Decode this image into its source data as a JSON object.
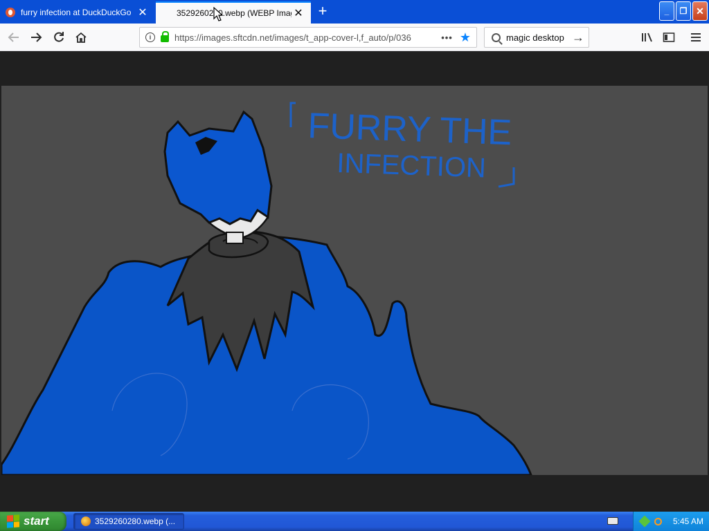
{
  "browser": {
    "tabs": [
      {
        "title": "furry infection at DuckDuckGo",
        "active": false
      },
      {
        "title": "3529260280.webp (WEBP Image,",
        "active": true
      }
    ],
    "url": "https://images.sftcdn.net/images/t_app-cover-l,f_auto/p/036",
    "search": "magic desktop"
  },
  "image": {
    "caption_line1": "FURRY THE",
    "caption_line2": "INFECTION",
    "colors": {
      "background": "#4c4c4c",
      "slime_blue": "#0a55c8",
      "hair_blue": "#0b57cf",
      "cloak": "#3c3c3c",
      "text_blue": "#1d62c9"
    }
  },
  "taskbar": {
    "start_label": "start",
    "task_item": "3529260280.webp (...",
    "clock": "5:45 AM"
  },
  "icons": {
    "back": "arrow-left-icon",
    "forward": "arrow-right-icon",
    "reload": "reload-icon",
    "home": "home-icon",
    "info": "info-icon",
    "lock": "lock-icon",
    "more": "more-dots-icon",
    "bookmark": "star-icon",
    "search": "search-icon",
    "go": "arrow-right-icon",
    "library": "library-icon",
    "sidebar": "sidebar-icon",
    "menu": "hamburger-icon"
  }
}
